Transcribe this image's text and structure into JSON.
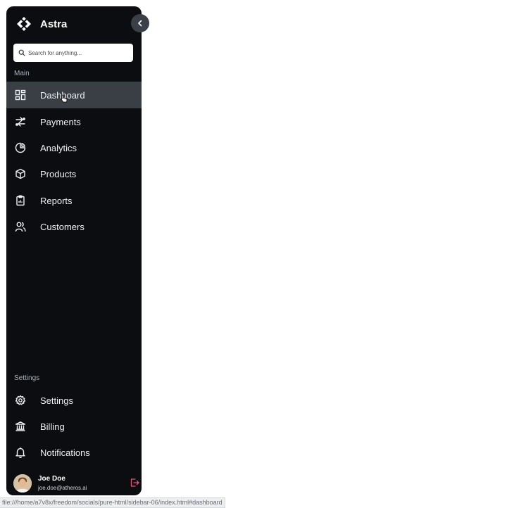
{
  "brand": {
    "name": "Astra"
  },
  "search": {
    "placeholder": "Search for anything..."
  },
  "sections": {
    "main": "Main",
    "settings": "Settings"
  },
  "nav": [
    {
      "label": "Dashboard",
      "icon": "dashboard-icon",
      "active": true
    },
    {
      "label": "Payments",
      "icon": "payments-icon"
    },
    {
      "label": "Analytics",
      "icon": "analytics-icon"
    },
    {
      "label": "Products",
      "icon": "box-icon"
    },
    {
      "label": "Reports",
      "icon": "clipboard-icon"
    },
    {
      "label": "Customers",
      "icon": "users-icon"
    }
  ],
  "settings_nav": [
    {
      "label": "Settings",
      "icon": "gear-icon"
    },
    {
      "label": "Billing",
      "icon": "bank-icon"
    },
    {
      "label": "Notifications",
      "icon": "bell-icon"
    }
  ],
  "user": {
    "name": "Joe Doe",
    "email": "joe.doe@atheros.ai"
  },
  "status_bar": {
    "url": "file:///home/a7v8x/freedom/socials/pure-html/sidebar-06/index.html#dashboard"
  },
  "colors": {
    "sidebar_bg": "#0b0d10",
    "active_bg": "#3a3f46",
    "logout_accent": "#e2557a"
  }
}
